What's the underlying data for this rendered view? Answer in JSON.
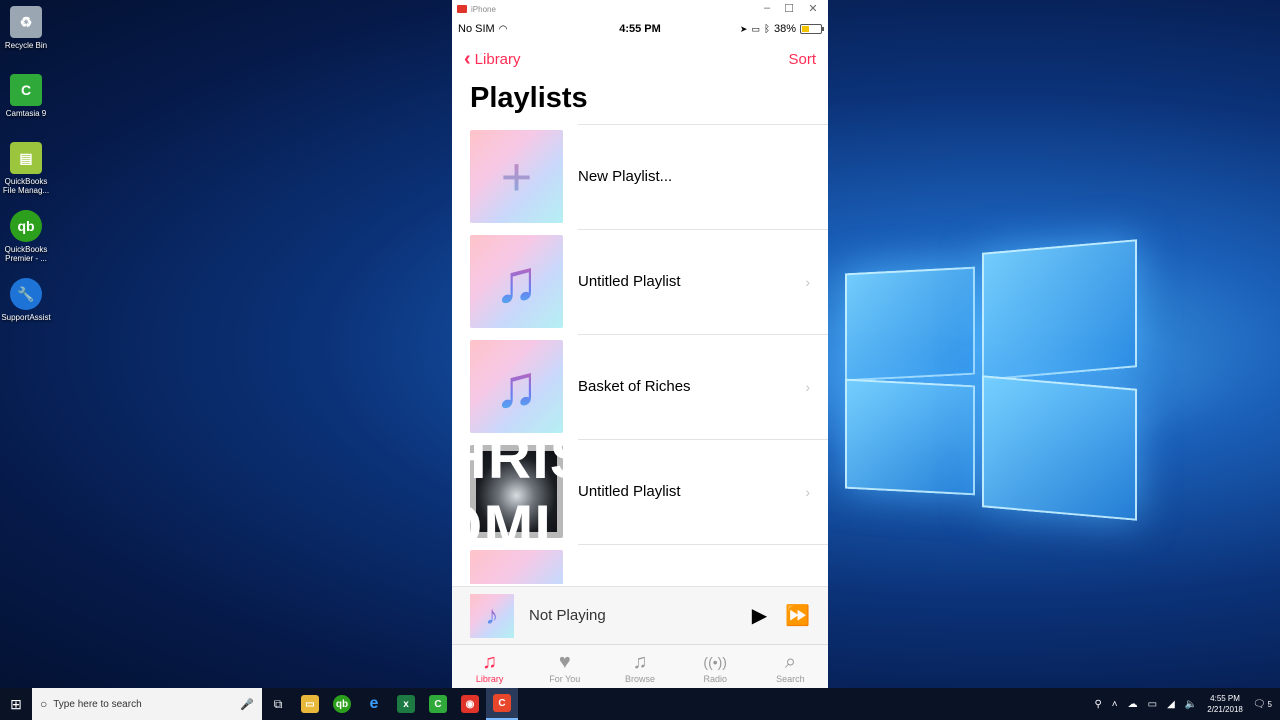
{
  "desktop": {
    "icons": [
      {
        "label": "Recycle Bin",
        "icon": "recycle-bin-icon",
        "color": "#9aa6b2"
      },
      {
        "label": "Camtasia 9",
        "icon": "camtasia-icon",
        "color": "#2faa3a"
      },
      {
        "label": "QuickBooks File Manag...",
        "icon": "quickbooks-file-manager-icon",
        "color": "#9bc53d"
      },
      {
        "label": "QuickBooks Premier - ...",
        "icon": "quickbooks-icon",
        "color": "#2ca01c"
      },
      {
        "label": "SupportAssist",
        "icon": "supportassist-icon",
        "color": "#1e73d6"
      }
    ]
  },
  "window": {
    "title": "iPhone",
    "controls": {
      "minimize": "–",
      "maximize": "☐",
      "close": "✕"
    }
  },
  "status": {
    "carrier": "No SIM",
    "time": "4:55 PM",
    "battery": "38%",
    "battery_level": 0.38
  },
  "nav": {
    "back_label": "Library",
    "sort_label": "Sort"
  },
  "page": {
    "title": "Playlists"
  },
  "playlists": [
    {
      "label": "New Playlist...",
      "type": "new"
    },
    {
      "label": "Untitled Playlist",
      "type": "note"
    },
    {
      "label": "Basket of Riches",
      "type": "note"
    },
    {
      "label": "Untitled Playlist",
      "type": "album",
      "album_text": "CHRIS TOMLIN"
    }
  ],
  "mini_player": {
    "label": "Not Playing"
  },
  "tabs": [
    {
      "label": "Library",
      "icon": "library-icon",
      "glyph": "♫",
      "active": true
    },
    {
      "label": "For You",
      "icon": "heart-icon",
      "glyph": "♥",
      "active": false
    },
    {
      "label": "Browse",
      "icon": "music-note-icon",
      "glyph": "♫",
      "active": false
    },
    {
      "label": "Radio",
      "icon": "radio-icon",
      "glyph": "((•))",
      "active": false
    },
    {
      "label": "Search",
      "icon": "search-icon",
      "glyph": "⌕",
      "active": false
    }
  ],
  "taskbar": {
    "search_placeholder": "Type here to search",
    "time": "4:55 PM",
    "date": "2/21/2018",
    "notifications": "5"
  },
  "colors": {
    "accent": "#ff2d55"
  }
}
